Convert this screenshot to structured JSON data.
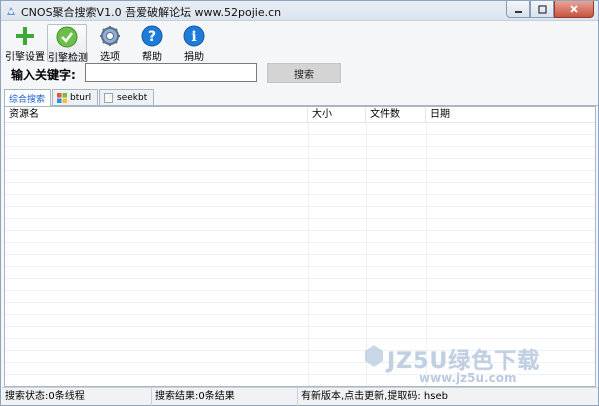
{
  "window": {
    "title": "CNOS聚合搜索V1.0  吾爱破解论坛 www.52pojie.cn"
  },
  "toolbar": {
    "items": [
      {
        "label": "引擎设置",
        "icon": "plus-icon"
      },
      {
        "label": "引擎检测",
        "icon": "check-icon"
      },
      {
        "label": "选项",
        "icon": "gear-icon"
      },
      {
        "label": "帮助",
        "icon": "help-icon"
      },
      {
        "label": "捐助",
        "icon": "info-icon"
      }
    ]
  },
  "search": {
    "label": "输入关键字:",
    "value": "",
    "button_label": "搜索"
  },
  "tabs": [
    {
      "label": "综合搜索",
      "active": true
    },
    {
      "label": "bturl",
      "active": false
    },
    {
      "label": "seekbt",
      "active": false
    }
  ],
  "results": {
    "columns": [
      "资源名",
      "大小",
      "文件数",
      "日期"
    ],
    "rows": []
  },
  "status": {
    "search_state": "搜索状态:0条线程",
    "search_result": "搜索结果:0条结果",
    "update_notice": "有新版本,点击更新,提取码: hseb"
  },
  "watermark": {
    "title": "JZ5U绿色下载",
    "url": "www.jz5u.com"
  },
  "colors": {
    "accent": "#1f5fd1",
    "green": "#3aaa35",
    "blue_icon": "#1f7bd8"
  }
}
